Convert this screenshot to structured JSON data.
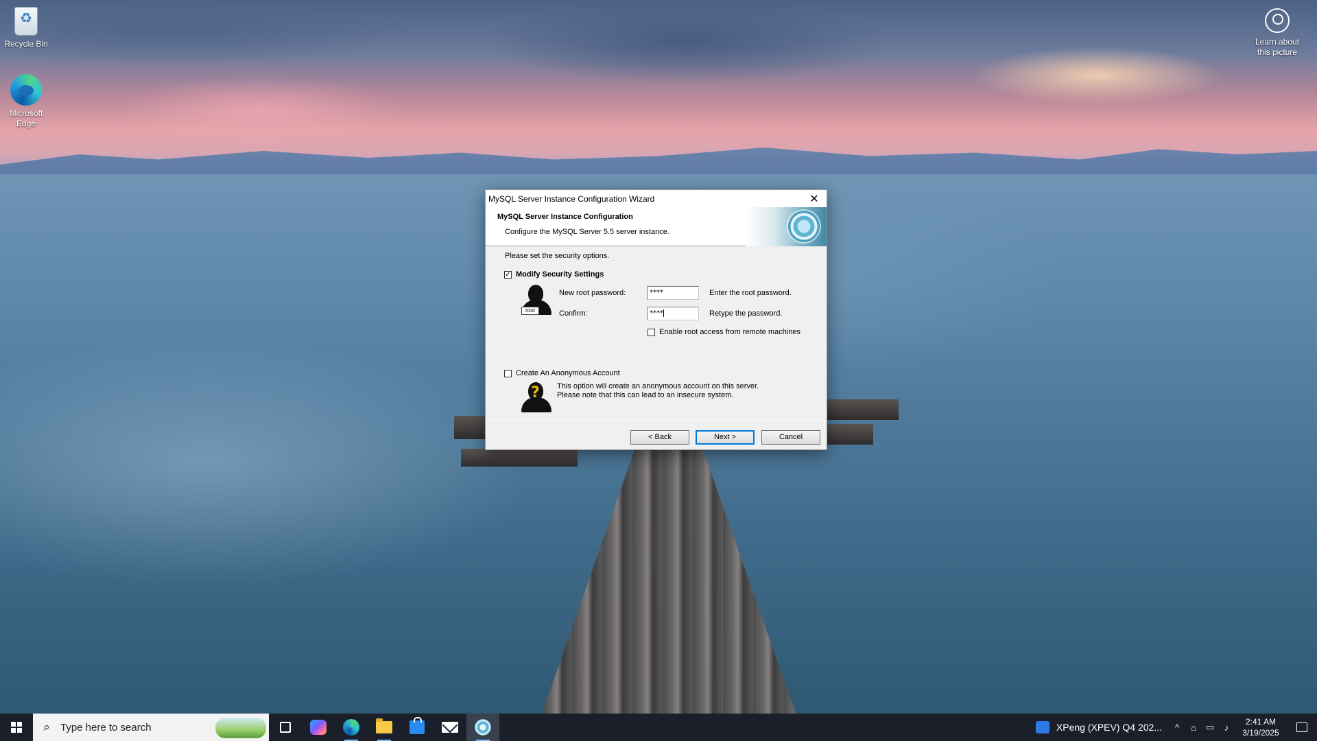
{
  "desktop": {
    "icons": [
      {
        "label": "Recycle Bin",
        "icon": "recycle-bin-icon"
      },
      {
        "label": "Microsoft Edge",
        "icon": "edge-icon"
      }
    ],
    "learn_about": "Learn about this picture"
  },
  "dialog": {
    "window_title": "MySQL Server Instance Configuration Wizard",
    "header_title": "MySQL Server Instance Configuration",
    "header_subtitle": "Configure the MySQL Server 5.5 server instance.",
    "intro": "Please set the security options.",
    "modify_security": {
      "label": "Modify Security Settings",
      "checked": true,
      "check_glyph": "✓"
    },
    "new_password": {
      "label": "New root password:",
      "value": "****",
      "hint": "Enter the root password."
    },
    "confirm_password": {
      "label": "Confirm:",
      "value": "****",
      "hint": "Retype the password."
    },
    "remote_access": {
      "label": "Enable root access from remote machines",
      "checked": false
    },
    "root_tag": "root",
    "anonymous": {
      "label": "Create An Anonymous Account",
      "checked": false,
      "description_line1": "This option will create an anonymous account on this server.",
      "description_line2": "Please note that this can lead to an insecure system."
    },
    "buttons": {
      "back": "< Back",
      "next": "Next >",
      "cancel": "Cancel"
    },
    "close_glyph": "✕"
  },
  "taskbar": {
    "search_placeholder": "Type here to search",
    "search_glyph": "⌕",
    "pinned": [
      "task-view-icon",
      "copilot-icon",
      "edge-icon",
      "file-explorer-icon",
      "store-icon",
      "mail-icon",
      "mysql-wizard-icon"
    ],
    "news": "XPeng (XPEV) Q4 202...",
    "tray_chevron": "^",
    "time": "2:41 AM",
    "date": "3/19/2025"
  },
  "colors": {
    "accent": "#0078d7",
    "taskbar": "#1a1f2a",
    "dialog_bg": "#f0f0f0"
  }
}
